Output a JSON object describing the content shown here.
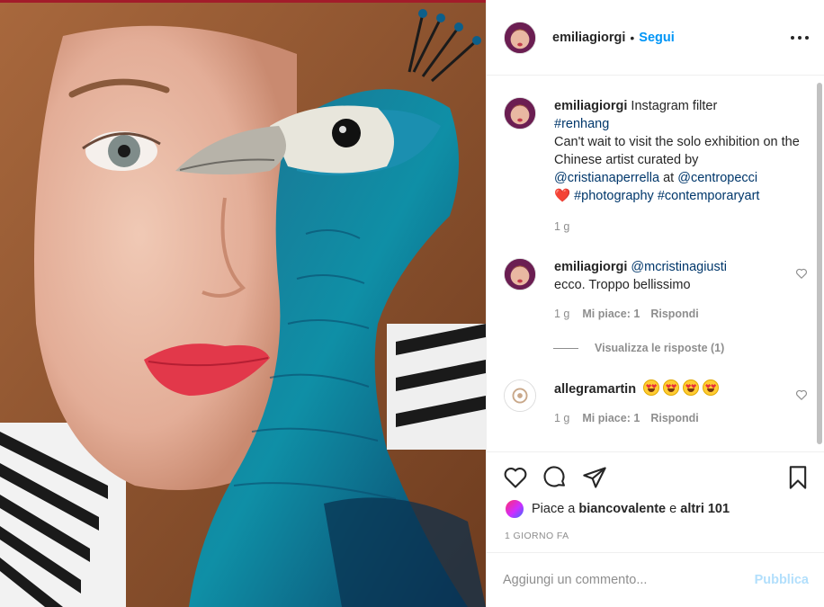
{
  "post": {
    "username": "emiliagiorgi",
    "follow_separator": "•",
    "follow_label": "Segui",
    "more_icon": "more-horizontal-icon"
  },
  "caption": {
    "username": "emiliagiorgi",
    "text_1": " Instagram filter",
    "hashtag_1": "#renhang",
    "text_2": "Can't wait to visit the solo exhibition on the Chinese artist curated by",
    "mention_1": "@cristianaperrella",
    "text_3": " at ",
    "mention_2": "@centropecci",
    "heart": "❤️",
    "hashtag_2": "#photography",
    "hashtag_3": "#contemporaryart",
    "time": "1 g"
  },
  "comments": [
    {
      "username": "emiliagiorgi",
      "mention": "@mcristinagiusti",
      "text": "ecco. Troppo bellissimo",
      "time": "1 g",
      "likes": "Mi piace: 1",
      "reply": "Rispondi",
      "view_replies": "Visualizza le risposte (1)"
    },
    {
      "username": "allegramartin",
      "emoji_count": 4,
      "emoji_icon": "star-struck-emoji",
      "time": "1 g",
      "likes": "Mi piace: 1",
      "reply": "Rispondi"
    }
  ],
  "actions": {
    "like_icon": "heart-icon",
    "comment_icon": "comment-bubble-icon",
    "share_icon": "paper-plane-icon",
    "save_icon": "bookmark-icon",
    "likes_prefix": "Piace a ",
    "liked_by": "biancovalente",
    "likes_mid": " e ",
    "likes_others": "altri 101",
    "date": "1 GIORNO FA"
  },
  "add_comment": {
    "placeholder": "Aggiungi un commento...",
    "publish_label": "Pubblica"
  },
  "colors": {
    "link_blue": "#0095f6",
    "tag_blue": "#00376b",
    "muted": "#8e8e8e",
    "publish_disabled": "#b2dffc"
  }
}
